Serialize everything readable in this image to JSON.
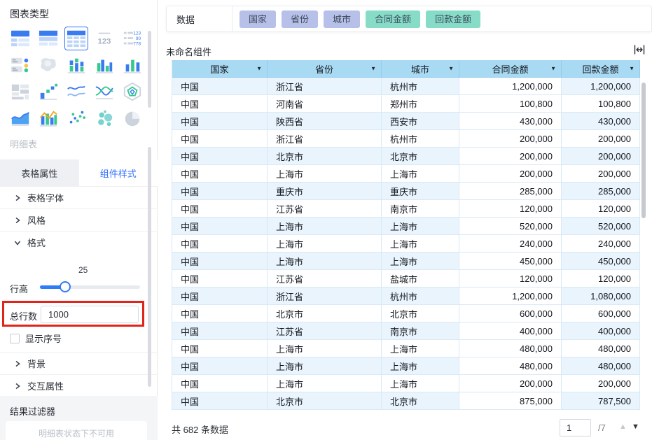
{
  "sidebar": {
    "title": "图表类型",
    "chart_icons": [
      {
        "name": "table-header-left",
        "selected": false
      },
      {
        "name": "table-header-rows",
        "selected": false
      },
      {
        "name": "table-grid",
        "selected": true
      },
      {
        "name": "number-card",
        "selected": false
      },
      {
        "name": "kpi-list",
        "selected": false
      },
      {
        "name": "indicator-dots",
        "selected": false
      },
      {
        "name": "map",
        "selected": false
      },
      {
        "name": "stacked-bar",
        "selected": false
      },
      {
        "name": "grouped-bar",
        "selected": false
      },
      {
        "name": "bar",
        "selected": false
      },
      {
        "name": "treemap",
        "selected": false
      },
      {
        "name": "step-scatter",
        "selected": false
      },
      {
        "name": "line-multi",
        "selected": false
      },
      {
        "name": "area-cross",
        "selected": false
      },
      {
        "name": "radar",
        "selected": false
      },
      {
        "name": "area",
        "selected": false
      },
      {
        "name": "combo",
        "selected": false
      },
      {
        "name": "scatter",
        "selected": false
      },
      {
        "name": "bubble",
        "selected": false
      },
      {
        "name": "pie",
        "selected": false
      }
    ],
    "component_label": "明细表",
    "tabs": [
      {
        "label": "表格属性",
        "active": false
      },
      {
        "label": "组件样式",
        "active": true
      }
    ],
    "sections": [
      {
        "label": "表格字体",
        "expanded": false
      },
      {
        "label": "风格",
        "expanded": false
      },
      {
        "label": "格式",
        "expanded": true
      }
    ],
    "format": {
      "row_height_label": "行高",
      "row_height_value": "25",
      "total_rows_label": "总行数",
      "total_rows_value": "1000",
      "show_index_label": "显示序号",
      "show_index_checked": false
    },
    "sections_after": [
      {
        "label": "背景",
        "expanded": false
      },
      {
        "label": "交互属性",
        "expanded": false
      }
    ],
    "result_filter_label": "结果过滤器",
    "result_filter_hint": "明细表状态下不可用"
  },
  "toolbar": {
    "data_label": "数据",
    "dimension_chips": [
      "国家",
      "省份",
      "城市"
    ],
    "measure_chips": [
      "合同金额",
      "回款金额"
    ]
  },
  "component": {
    "title": "未命名组件"
  },
  "table": {
    "columns": [
      "国家",
      "省份",
      "城市",
      "合同金额",
      "回款金额"
    ],
    "numeric_columns": [
      3,
      4
    ],
    "rows": [
      [
        "中国",
        "浙江省",
        "杭州市",
        "1,200,000",
        "1,200,000"
      ],
      [
        "中国",
        "河南省",
        "郑州市",
        "100,800",
        "100,800"
      ],
      [
        "中国",
        "陕西省",
        "西安市",
        "430,000",
        "430,000"
      ],
      [
        "中国",
        "浙江省",
        "杭州市",
        "200,000",
        "200,000"
      ],
      [
        "中国",
        "北京市",
        "北京市",
        "200,000",
        "200,000"
      ],
      [
        "中国",
        "上海市",
        "上海市",
        "200,000",
        "200,000"
      ],
      [
        "中国",
        "重庆市",
        "重庆市",
        "285,000",
        "285,000"
      ],
      [
        "中国",
        "江苏省",
        "南京市",
        "120,000",
        "120,000"
      ],
      [
        "中国",
        "上海市",
        "上海市",
        "520,000",
        "520,000"
      ],
      [
        "中国",
        "上海市",
        "上海市",
        "240,000",
        "240,000"
      ],
      [
        "中国",
        "上海市",
        "上海市",
        "450,000",
        "450,000"
      ],
      [
        "中国",
        "江苏省",
        "盐城市",
        "120,000",
        "120,000"
      ],
      [
        "中国",
        "浙江省",
        "杭州市",
        "1,200,000",
        "1,080,000"
      ],
      [
        "中国",
        "北京市",
        "北京市",
        "600,000",
        "600,000"
      ],
      [
        "中国",
        "江苏省",
        "南京市",
        "400,000",
        "400,000"
      ],
      [
        "中国",
        "上海市",
        "上海市",
        "480,000",
        "480,000"
      ],
      [
        "中国",
        "上海市",
        "上海市",
        "480,000",
        "480,000"
      ],
      [
        "中国",
        "上海市",
        "上海市",
        "200,000",
        "200,000"
      ],
      [
        "中国",
        "北京市",
        "北京市",
        "875,000",
        "787,500"
      ]
    ]
  },
  "footer": {
    "total_prefix": "共",
    "total_count": "682",
    "total_suffix": "条数据",
    "page_value": "1",
    "page_total": "/7"
  },
  "colors": {
    "accent_blue": "#3370ff",
    "header_blue": "#a9daf3",
    "row_stripe": "#e9f4fd",
    "dimension_chip": "#b6c0e9",
    "measure_chip": "#86dcc7",
    "annotation_red": "#e2231a",
    "slider_blue": "#2e7cf6"
  }
}
